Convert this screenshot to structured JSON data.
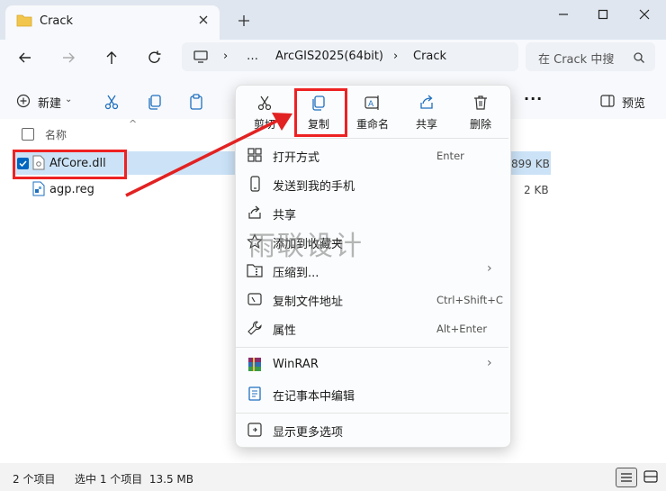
{
  "tab": {
    "title": "Crack"
  },
  "address": {
    "ellipsis": "…",
    "crumbs": [
      "ArcGIS2025(64bit)",
      "Crack"
    ]
  },
  "search": {
    "placeholder": "在 Crack 中搜"
  },
  "commandbar": {
    "new_label": "新建",
    "more_label": "···",
    "preview_label": "预览"
  },
  "list": {
    "column_name": "名称",
    "files": [
      {
        "name": "AfCore.dll",
        "size": "899 KB",
        "selected": true
      },
      {
        "name": "agp.reg",
        "size": "2 KB",
        "selected": false
      }
    ]
  },
  "status": {
    "count": "2 个项目",
    "selection": "选中 1 个项目  13.5 MB"
  },
  "context_menu": {
    "toolbar": [
      {
        "label": "剪切",
        "icon": "scissors-icon"
      },
      {
        "label": "复制",
        "icon": "copy-icon"
      },
      {
        "label": "重命名",
        "icon": "rename-icon"
      },
      {
        "label": "共享",
        "icon": "share-icon"
      },
      {
        "label": "删除",
        "icon": "trash-icon"
      }
    ],
    "items": [
      {
        "label": "打开方式",
        "shortcut": "Enter"
      },
      {
        "label": "发送到我的手机",
        "shortcut": ""
      },
      {
        "label": "共享",
        "shortcut": ""
      },
      {
        "label": "添加到收藏夹",
        "shortcut": ""
      },
      {
        "label": "压缩到...",
        "shortcut": ""
      },
      {
        "label": "复制文件地址",
        "shortcut": "Ctrl+Shift+C"
      },
      {
        "label": "属性",
        "shortcut": "Alt+Enter"
      },
      {
        "label": "WinRAR",
        "shortcut": ""
      },
      {
        "label": "在记事本中编辑",
        "shortcut": ""
      },
      {
        "label": "显示更多选项",
        "shortcut": ""
      }
    ]
  },
  "watermark": "雨联设计",
  "colors": {
    "highlight": "#e22222",
    "selection": "#cce3f7",
    "accent": "#0067c0"
  }
}
